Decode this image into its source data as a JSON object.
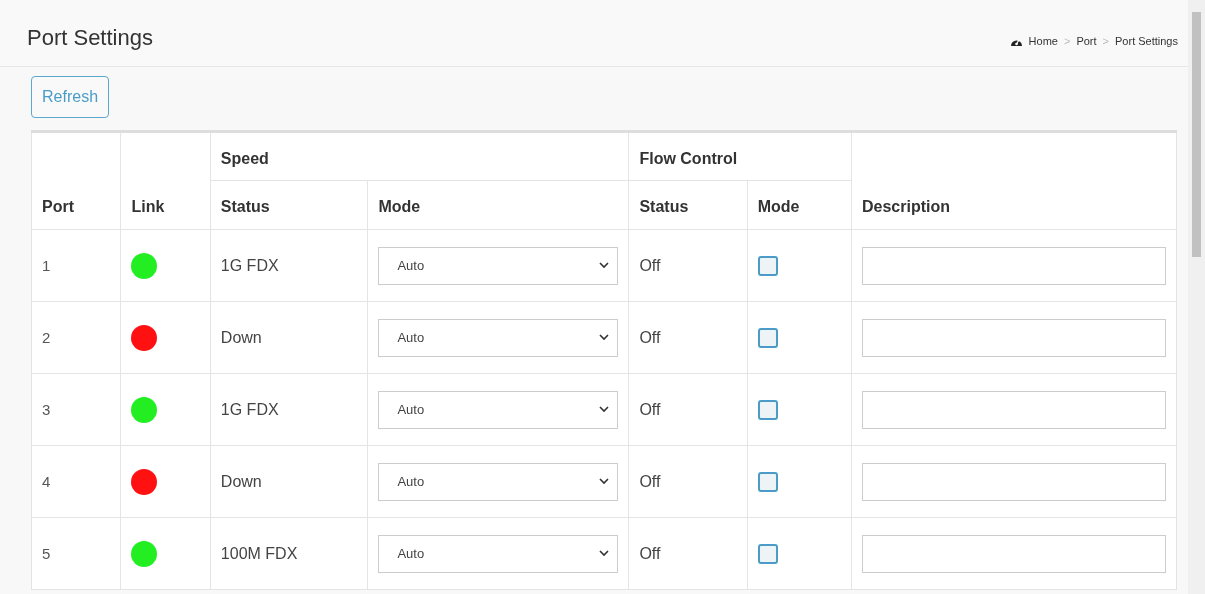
{
  "page": {
    "title": "Port Settings"
  },
  "breadcrumb": [
    "Home",
    "Port",
    "Port Settings"
  ],
  "breadcrumb_separator": ">",
  "refresh_button": "Refresh",
  "table": {
    "group_headers": {
      "port": "Port",
      "link": "Link",
      "speed": "Speed",
      "flow_control": "Flow Control",
      "description": "Description"
    },
    "sub_headers": {
      "speed_status": "Status",
      "speed_mode": "Mode",
      "flow_status": "Status",
      "flow_mode": "Mode"
    },
    "rows": [
      {
        "port": "1",
        "link": {
          "color": "#22ee22"
        },
        "speed_status": "1G FDX",
        "speed_mode": "Auto",
        "flow_status": "Off",
        "flow_mode_checked": false,
        "description": ""
      },
      {
        "port": "2",
        "link": {
          "color": "#ff1111"
        },
        "speed_status": "Down",
        "speed_mode": "Auto",
        "flow_status": "Off",
        "flow_mode_checked": false,
        "description": ""
      },
      {
        "port": "3",
        "link": {
          "color": "#22ee22"
        },
        "speed_status": "1G FDX",
        "speed_mode": "Auto",
        "flow_status": "Off",
        "flow_mode_checked": false,
        "description": ""
      },
      {
        "port": "4",
        "link": {
          "color": "#ff1111"
        },
        "speed_status": "Down",
        "speed_mode": "Auto",
        "flow_status": "Off",
        "flow_mode_checked": false,
        "description": ""
      },
      {
        "port": "5",
        "link": {
          "color": "#22ee22"
        },
        "speed_status": "100M FDX",
        "speed_mode": "Auto",
        "flow_status": "Off",
        "flow_mode_checked": false,
        "description": ""
      }
    ]
  }
}
